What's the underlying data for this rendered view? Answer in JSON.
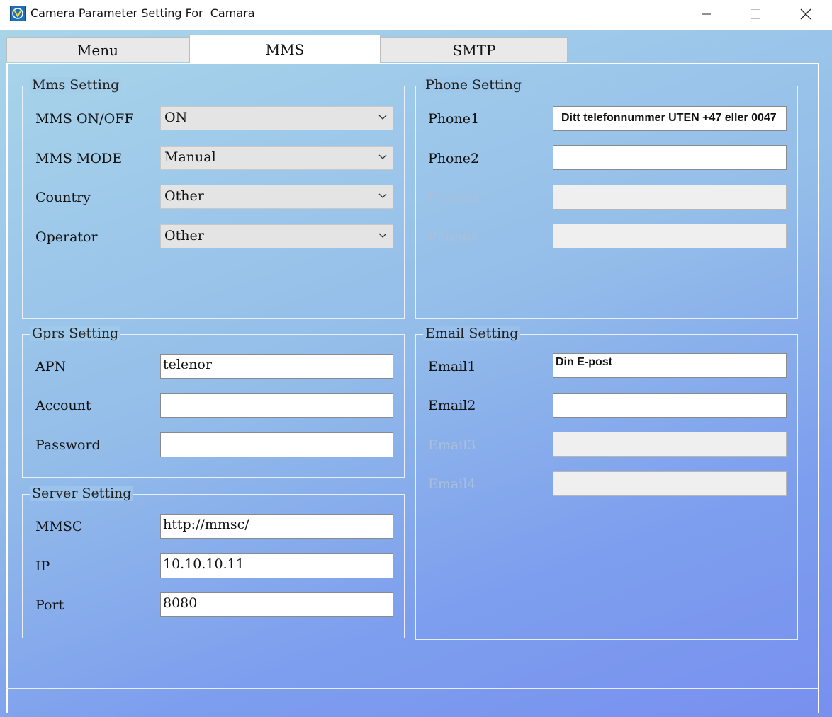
{
  "window": {
    "title": "Camera Parameter Setting For  Camara",
    "icon": "app-camera-icon",
    "controls": [
      "minimize-icon",
      "maximize-icon",
      "close-icon"
    ]
  },
  "tabs": [
    {
      "label": "Menu",
      "active": false
    },
    {
      "label": "MMS",
      "active": true
    },
    {
      "label": "SMTP",
      "active": false
    }
  ],
  "mms_setting": {
    "legend": "Mms Setting",
    "fields": [
      {
        "label": "MMS ON/OFF",
        "value": "ON"
      },
      {
        "label": "MMS MODE",
        "value": "Manual"
      },
      {
        "label": "Country",
        "value": "Other"
      },
      {
        "label": "Operator",
        "value": "Other"
      }
    ]
  },
  "gprs_setting": {
    "legend": "Gprs Setting",
    "fields": [
      {
        "label": "APN",
        "value": "telenor"
      },
      {
        "label": "Account",
        "value": ""
      },
      {
        "label": "Password",
        "value": ""
      }
    ]
  },
  "server_setting": {
    "legend": "Server Setting",
    "fields": [
      {
        "label": "MMSC",
        "value": "http://mmsc/"
      },
      {
        "label": "IP",
        "value": "10.10.10.11"
      },
      {
        "label": "Port",
        "value": "8080"
      }
    ]
  },
  "phone_setting": {
    "legend": "Phone Setting",
    "fields": [
      {
        "label": "Phone1",
        "value": "Ditt telefonnummer UTEN +47 eller 0047",
        "enabled": true
      },
      {
        "label": "Phone2",
        "value": "",
        "enabled": true
      },
      {
        "label": "Phone3",
        "value": "",
        "enabled": false
      },
      {
        "label": "Phone4",
        "value": "",
        "enabled": false
      }
    ]
  },
  "email_setting": {
    "legend": "Email Setting",
    "fields": [
      {
        "label": "Email1",
        "value": "Din E-post",
        "enabled": true
      },
      {
        "label": "Email2",
        "value": "",
        "enabled": true
      },
      {
        "label": "Email3",
        "value": "",
        "enabled": false
      },
      {
        "label": "Email4",
        "value": "",
        "enabled": false
      }
    ]
  },
  "colors": {
    "background_top": "#a8d5ea",
    "background_bottom": "#7890ef",
    "disabled_label": "#a9c0da"
  }
}
